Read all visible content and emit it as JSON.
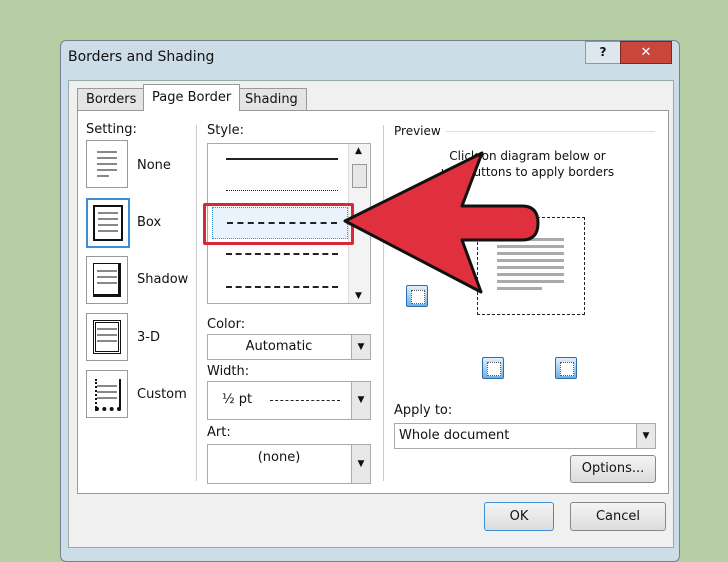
{
  "window": {
    "title": "Borders and Shading",
    "help": "?",
    "close": "✕"
  },
  "tabs": [
    {
      "label": "Borders"
    },
    {
      "label": "Page Border"
    },
    {
      "label": "Shading"
    }
  ],
  "setting": {
    "label": "Setting:",
    "items": [
      {
        "label": "None"
      },
      {
        "label": "Box"
      },
      {
        "label": "Shadow"
      },
      {
        "label": "3-D"
      },
      {
        "label": "Custom"
      }
    ]
  },
  "style": {
    "label": "Style:"
  },
  "color": {
    "label": "Color:",
    "value": "Automatic"
  },
  "width": {
    "label": "Width:",
    "value": "½ pt"
  },
  "art": {
    "label": "Art:",
    "value": "(none)"
  },
  "preview": {
    "label": "Preview",
    "instructions_1": "Click on diagram below or",
    "instructions_2": "use buttons to apply borders"
  },
  "apply_to": {
    "label": "Apply to:",
    "value": "Whole document"
  },
  "buttons": {
    "options": "Options...",
    "ok": "OK",
    "cancel": "Cancel"
  },
  "colors": {
    "arrow": "#e0303e",
    "highlight": "#d9263a"
  }
}
